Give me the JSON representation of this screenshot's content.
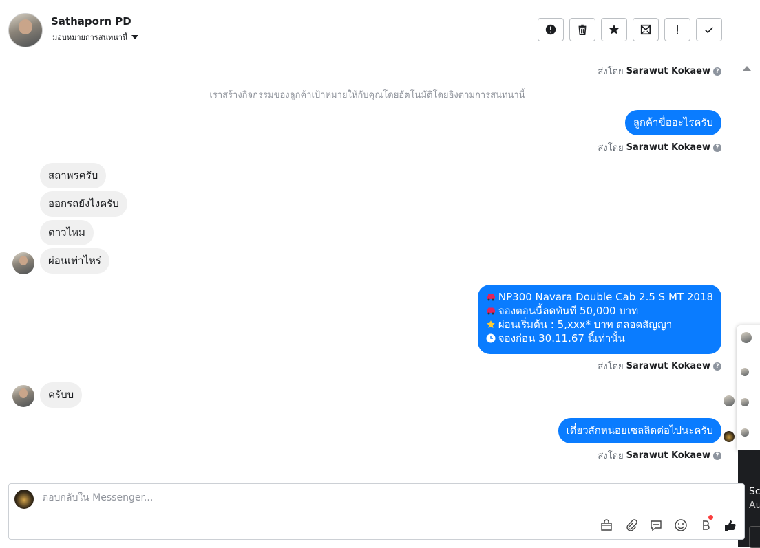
{
  "header": {
    "contact_name": "Sathaporn PD",
    "assign_label": "มอบหมายการสนทนานี้",
    "toolbar": [
      {
        "name": "alert-icon"
      },
      {
        "name": "trash-icon"
      },
      {
        "name": "star-icon"
      },
      {
        "name": "mark-unread-icon"
      },
      {
        "name": "exclamation-icon"
      },
      {
        "name": "check-icon"
      }
    ]
  },
  "sent_by_prefix": "ส่งโดย",
  "sender_name": "Sarawut Kokaew",
  "system_note": "เราสร้างกิจกรรมของลูกค้าเป้าหมายให้กับคุณโดยอัตโนมัติโดยอิงตามการสนทนานี้",
  "messages": {
    "out1": "ลูกค้าขื่ออะไรครับ",
    "in1": "สถาพรครับ",
    "in2": "ออกรถยังไงครับ",
    "in3": "ดาวไหม",
    "in4": "ผ่อนเท่าไหร่",
    "promo": [
      "NP300 Navara Double Cab 2.5 S MT 2018",
      "จองตอนนี้ลดทันที 50,000 บาท",
      "ผ่อนเริ่มต้น : 5,xxx* บาท ตลอดสัญญา",
      "จองก่อน 30.11.67 นี้เท่านั้น"
    ],
    "in5": "ครับบ",
    "out3": "เดี๋ยวสักหน่อยเซลลิดต่อไปนะครับ"
  },
  "composer": {
    "placeholder": "ตอบกลับใน Messenger...",
    "tools": [
      "shop-icon",
      "paperclip-icon",
      "saved-reply-icon",
      "emoji-icon",
      "payment-icon",
      "like-icon"
    ]
  },
  "side": {
    "line1": "Scr",
    "line2": "Au"
  },
  "colors": {
    "outgoing_bubble": "#0a7cff",
    "incoming_bubble": "#f0f0f0",
    "like_blue": "#1877f2"
  }
}
